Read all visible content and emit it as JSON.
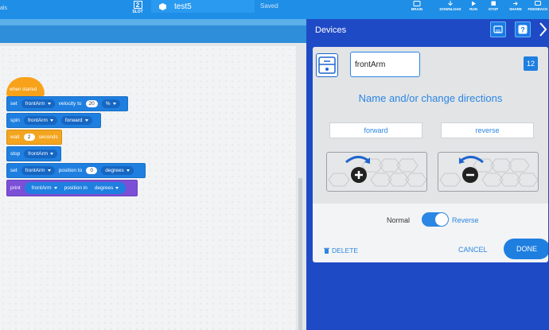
{
  "topbar": {
    "tail_label": "als",
    "slot": {
      "number": "2",
      "label": "SLOT"
    },
    "project_name": "test5",
    "status": "Saved",
    "buttons": [
      {
        "label": "BRAIN",
        "icon": "brain-icon"
      },
      {
        "label": "DOWNLOAD",
        "icon": "download-icon"
      },
      {
        "label": "RUN",
        "icon": "run-icon"
      },
      {
        "label": "STOP",
        "icon": "stop-icon"
      },
      {
        "label": "SHARE",
        "icon": "share-icon"
      },
      {
        "label": "FEEDBACK",
        "icon": "feedback-icon"
      }
    ]
  },
  "blocks": {
    "when_started": "when started",
    "b1": {
      "cmd": "set",
      "device": "frontArm",
      "text": "velocity to",
      "value": "20",
      "unit": "%"
    },
    "b2": {
      "cmd": "spin",
      "device": "frontArm",
      "direction": "forward"
    },
    "b3": {
      "cmd": "wait",
      "value": "2",
      "unit": "seconds"
    },
    "b4": {
      "cmd": "stop",
      "device": "frontArm"
    },
    "b5": {
      "cmd": "set",
      "device": "frontArm",
      "text": "position to",
      "value": "0",
      "unit": "degrees"
    },
    "b6": {
      "cmd": "print",
      "device": "frontArm",
      "text": "position in",
      "unit": "degrees"
    }
  },
  "devices": {
    "title": "Devices",
    "device_name": "frontArm",
    "port": "12",
    "heading": "Name and/or change directions",
    "forward_label": "forward",
    "reverse_label": "reverse",
    "toggle_off_label": "Normal",
    "toggle_on_label": "Reverse",
    "toggle_state": "Reverse",
    "delete_label": "DELETE",
    "cancel_label": "CANCEL",
    "done_label": "DONE"
  },
  "colors": {
    "topbar": "#1f8ee6",
    "devices_panel": "#1f4ac6",
    "motion_block": "#1e7fe0",
    "event_block": "#f7a21a",
    "looks_block": "#7b4fd6",
    "accent": "#2b86e4"
  }
}
